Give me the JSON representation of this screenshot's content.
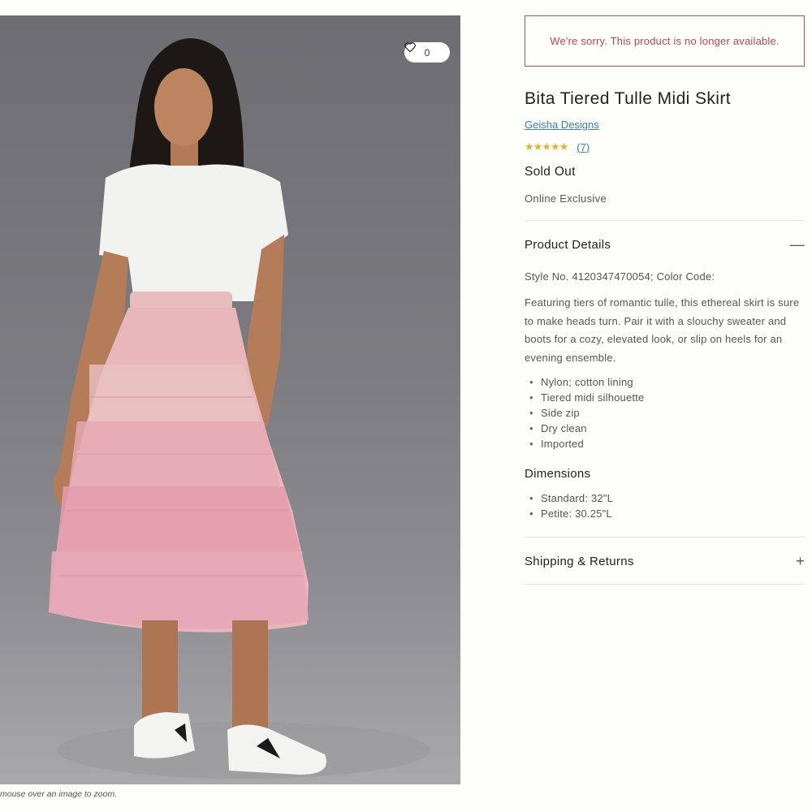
{
  "gallery": {
    "favorite_count": "0",
    "zoom_hint": "mouse over an image to zoom."
  },
  "notice": "We're sorry. This product is no longer available.",
  "product": {
    "title": "Bita Tiered Tulle Midi Skirt",
    "brand": "Geisha Designs",
    "rating_stars": "★★★★★",
    "review_count": "(7)",
    "availability": "Sold Out",
    "tag": "Online Exclusive"
  },
  "details": {
    "heading": "Product Details",
    "toggle": "—",
    "style_line": "Style No. 4120347470054; Color Code:",
    "description": "Featuring tiers of romantic tulle, this ethereal skirt is sure to make heads turn. Pair it with a slouchy sweater and boots for a cozy, elevated look, or slip on heels for an evening ensemble.",
    "features": [
      "Nylon; cotton lining",
      "Tiered midi silhouette",
      "Side zip",
      "Dry clean",
      "Imported"
    ],
    "dimensions_heading": "Dimensions",
    "dimensions": [
      "Standard: 32\"L",
      "Petite: 30.25\"L"
    ]
  },
  "shipping": {
    "heading": "Shipping & Returns",
    "toggle": "+"
  },
  "colors": {
    "alert": "#b5464e",
    "link": "#3a7fa8",
    "star": "#e0b13a"
  }
}
